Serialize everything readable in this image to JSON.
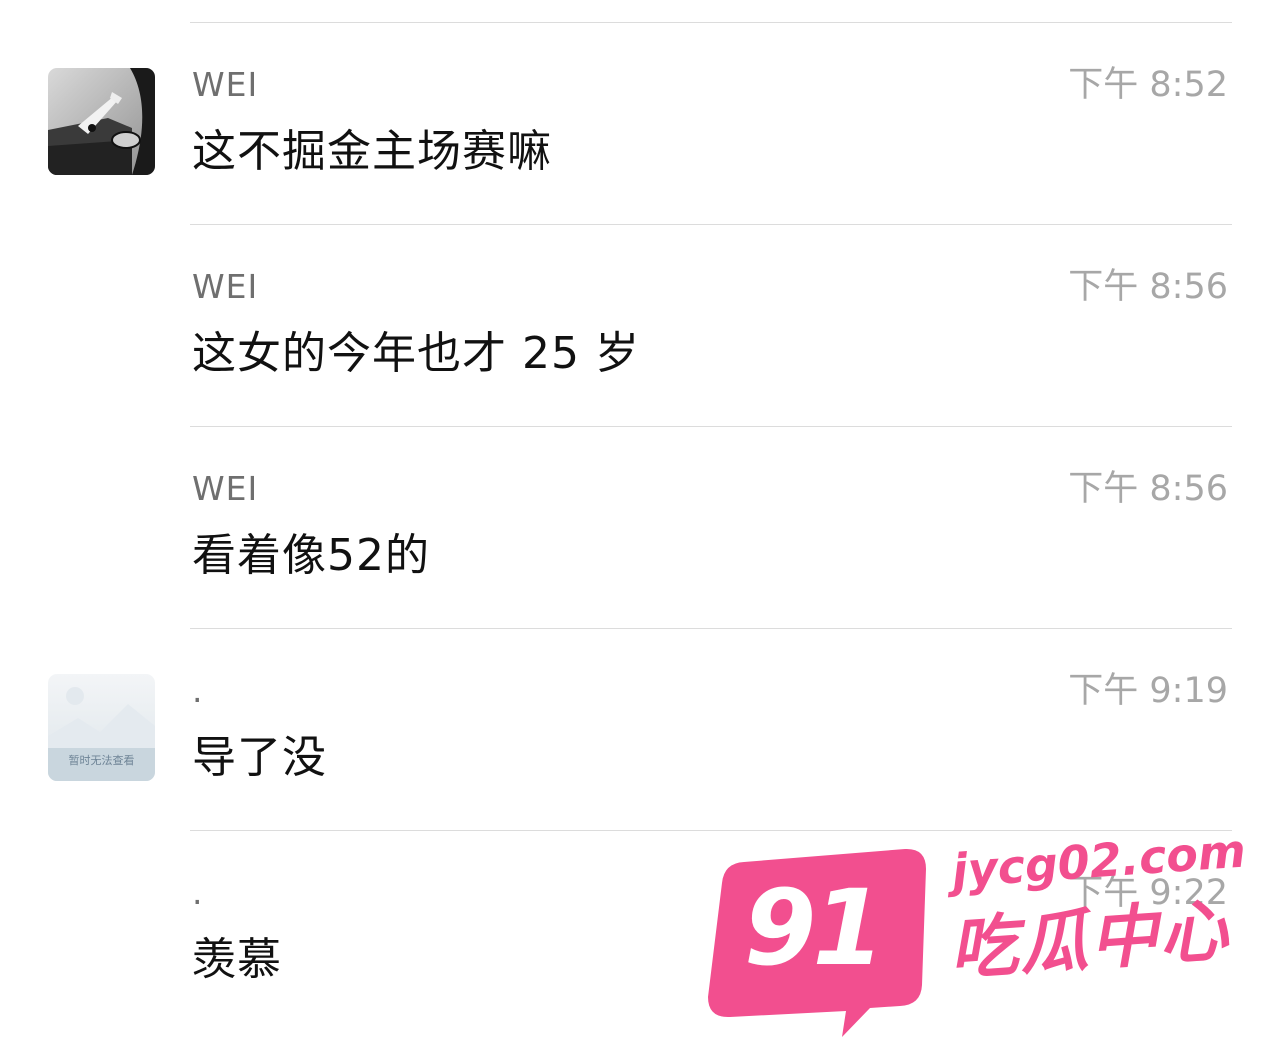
{
  "messages": [
    {
      "sender": "WEI",
      "time": "下午 8:52",
      "text": "这不掘金主场赛嘛",
      "avatar": "car-photo"
    },
    {
      "sender": "WEI",
      "time": "下午 8:56",
      "text": "这女的今年也才 25 岁"
    },
    {
      "sender": "WEI",
      "time": "下午 8:56",
      "text": "看着像52的"
    },
    {
      "sender": ".",
      "time": "下午 9:19",
      "text": "导了没",
      "avatar": "image-placeholder",
      "avatar_caption": "暂时无法查看"
    },
    {
      "sender": ".",
      "time": "下午 9:22",
      "text": "羡慕"
    }
  ],
  "watermark": {
    "number": "91",
    "url": "jycg02.com",
    "name": "吃瓜中心",
    "color": "#f24f8f"
  }
}
